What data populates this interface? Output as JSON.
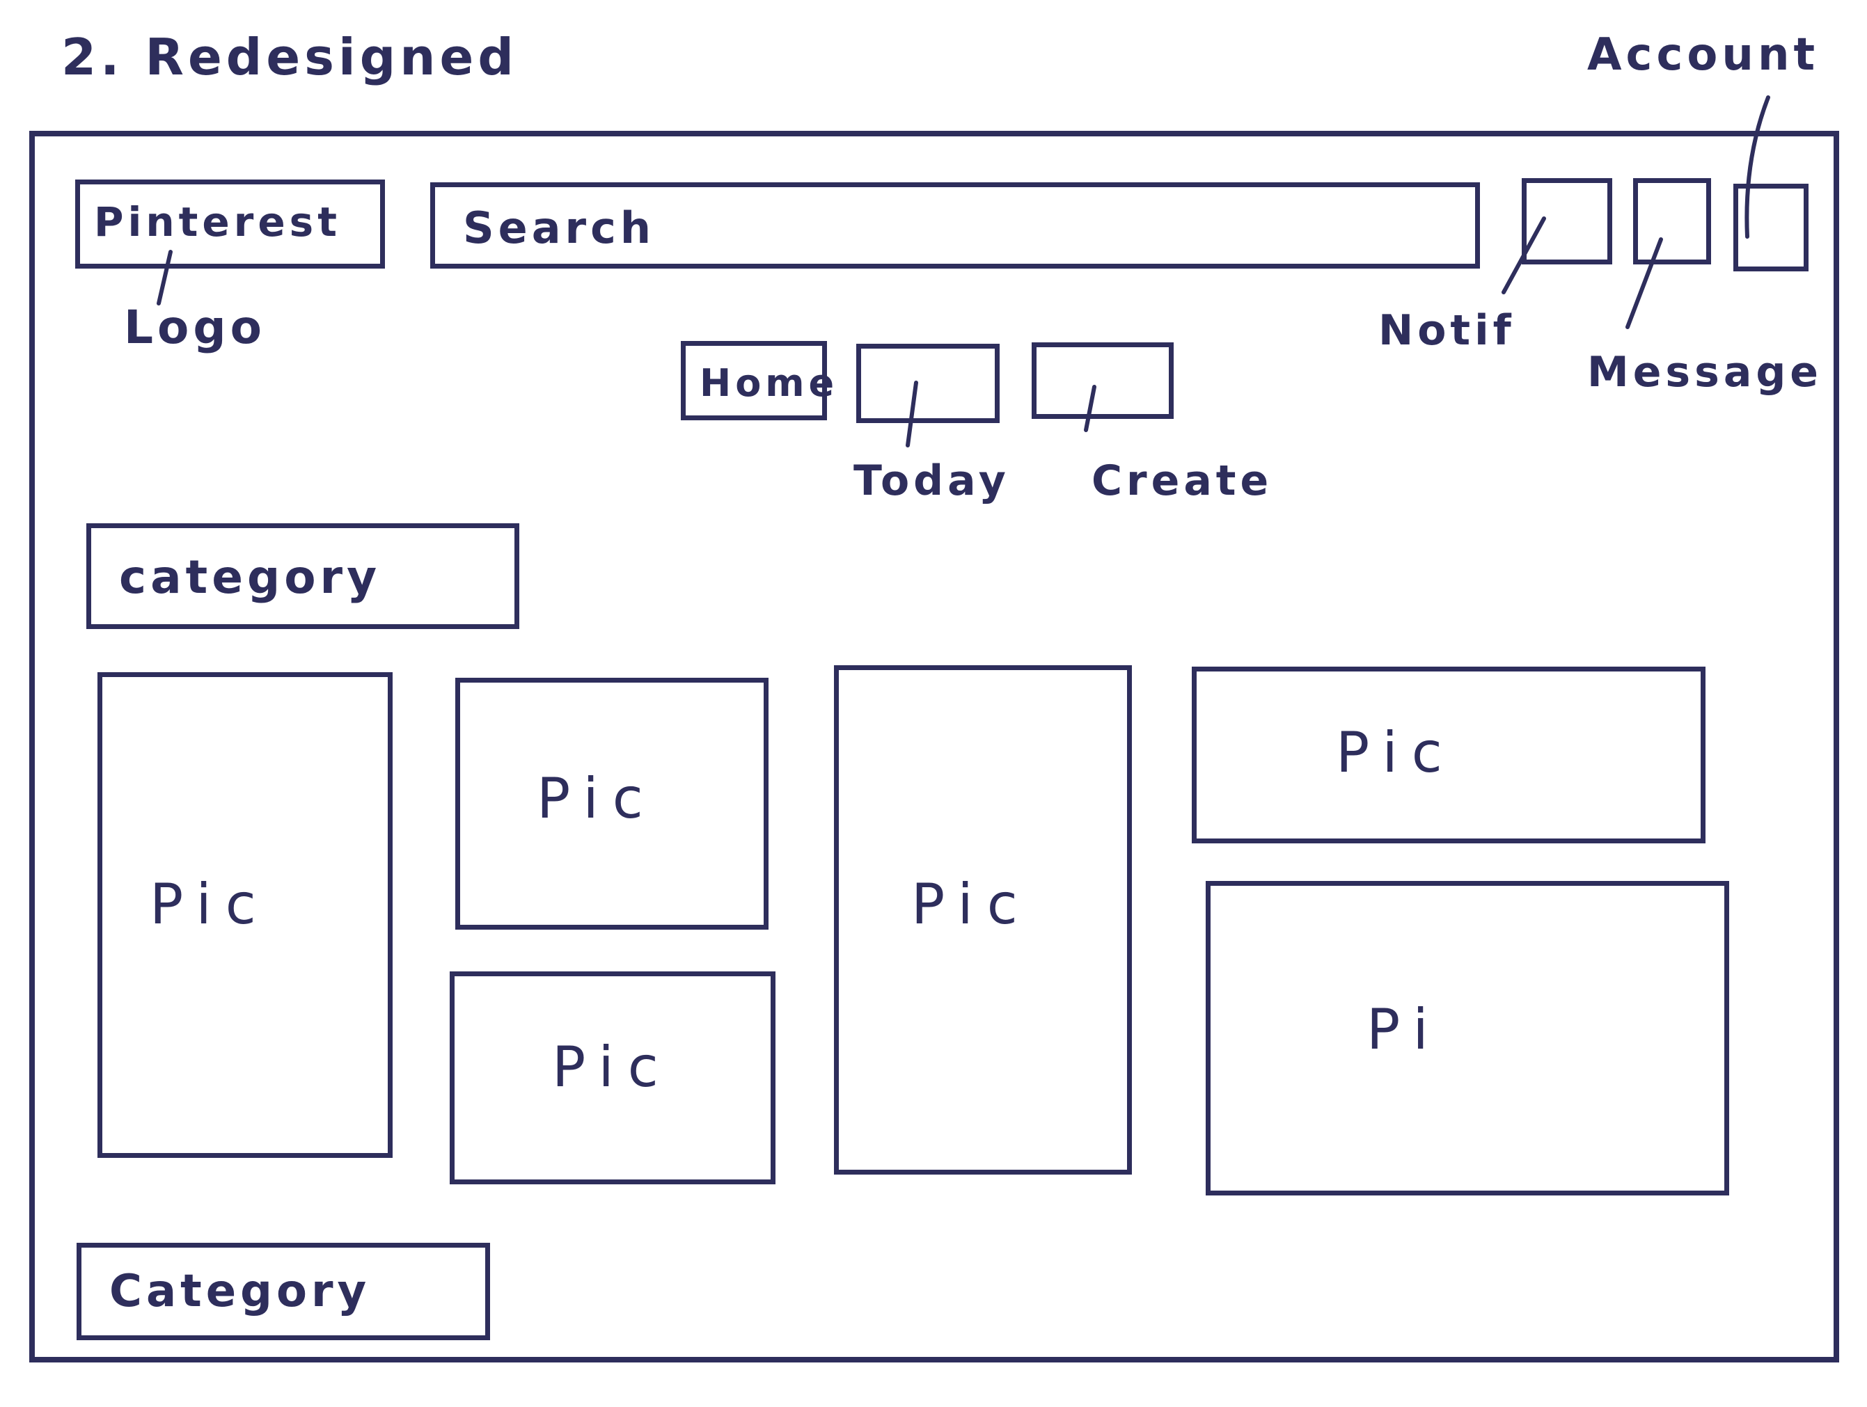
{
  "title": "2. Redesigned",
  "header": {
    "logo_box_text": "Pinterest",
    "search_text": "Search"
  },
  "annotations": {
    "logo": "Logo",
    "account": "Account",
    "notif": "Notif",
    "message": "Message",
    "today": "Today",
    "create": "Create"
  },
  "nav": {
    "home": "Home"
  },
  "categories": {
    "top": "category",
    "bottom": "Category"
  },
  "pins": [
    {
      "label": "Pic"
    },
    {
      "label": "Pic"
    },
    {
      "label": "Pic"
    },
    {
      "label": "Pic"
    },
    {
      "label": "Pic"
    },
    {
      "label": "Pi"
    }
  ],
  "colors": {
    "ink": "#2e2e5c",
    "background": "#ffffff"
  }
}
